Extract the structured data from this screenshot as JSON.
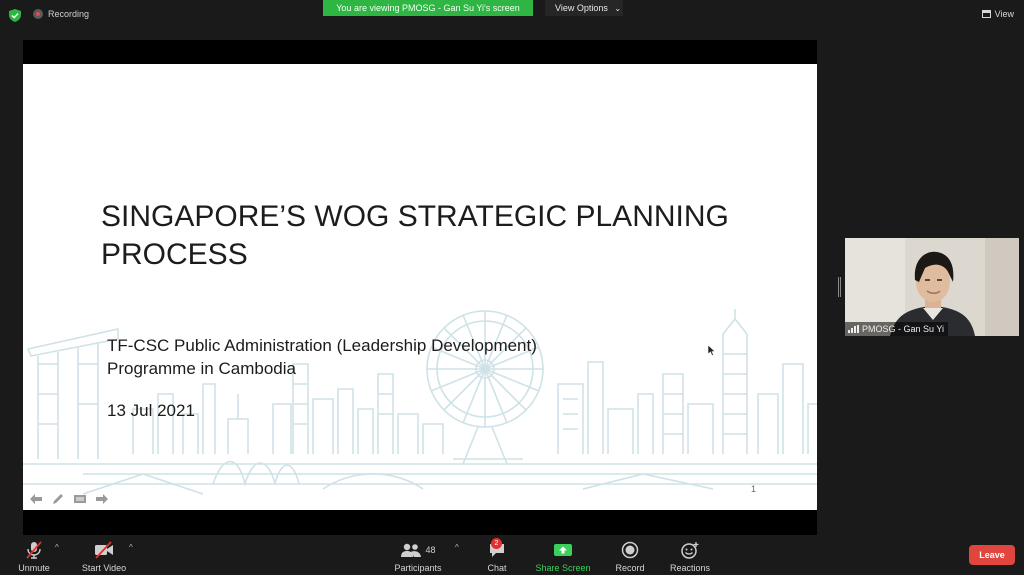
{
  "top_bar": {
    "recording_label": "Recording",
    "viewing_banner": "You are viewing PMOSG - Gan Su Yi's screen",
    "view_options_label": "View Options",
    "view_label": "View",
    "icons": [
      "shield-check-icon",
      "recording-icon",
      "chevron-down-icon",
      "grid-view-icon"
    ],
    "colors": {
      "banner": "#2fb543",
      "security": "#2fb543"
    }
  },
  "slide": {
    "title": "SINGAPORE’S WOG STRATEGIC PLANNING PROCESS",
    "subtitle_line1": "TF-CSC Public Administration (Leadership Development)",
    "subtitle_line2": "Programme in Cambodia",
    "date": "13 Jul 2021",
    "page_number": "1",
    "tools": [
      "arrow-left-icon",
      "pen-icon",
      "slides-icon",
      "arrow-right-icon"
    ]
  },
  "participant": {
    "name": "PMOSG - Gan Su Yi"
  },
  "toolbar": {
    "unmute_label": "Unmute",
    "start_video_label": "Start Video",
    "participants_label": "Participants",
    "participants_count": "48",
    "chat_label": "Chat",
    "chat_badge": "2",
    "share_screen_label": "Share Screen",
    "record_label": "Record",
    "reactions_label": "Reactions",
    "leave_label": "Leave",
    "colors": {
      "share": "#3ad05a",
      "leave": "#e0453e",
      "muted": "#e0312f"
    }
  }
}
